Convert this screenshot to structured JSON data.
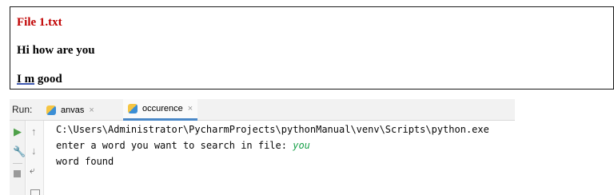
{
  "document": {
    "title": "File 1.txt",
    "line1": "Hi how are you",
    "line2_underlined": "I m",
    "line2_rest": " good"
  },
  "run_panel": {
    "label": "Run:",
    "tabs": [
      {
        "label": "anvas",
        "close": "×",
        "active": false
      },
      {
        "label": "occurence",
        "close": "×",
        "active": true
      }
    ],
    "console": {
      "path_line": "C:\\Users\\Administrator\\PycharmProjects\\pythonManual\\venv\\Scripts\\python.exe",
      "prompt": "enter a word you want to search in file: ",
      "user_input": "you",
      "result": "word found"
    }
  },
  "colors": {
    "title_red": "#c00000",
    "input_green": "#19a14a",
    "run_green": "#4fa14a",
    "active_tab_blue": "#4a88c7"
  }
}
